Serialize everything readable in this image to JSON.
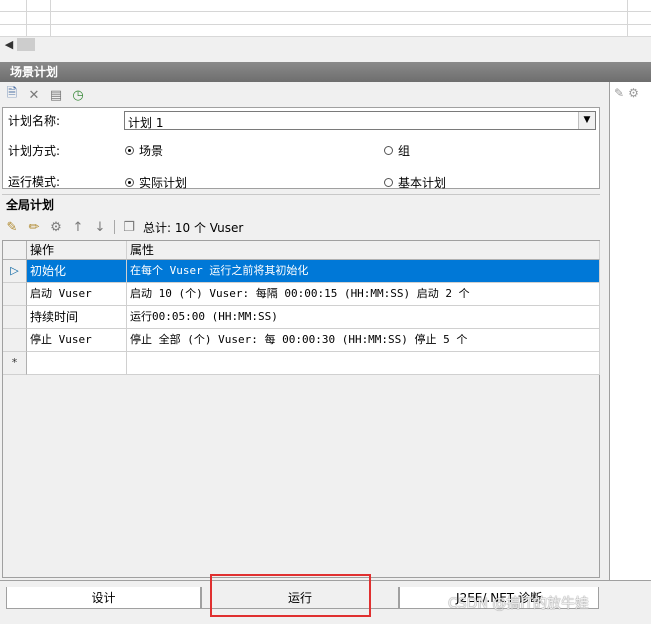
{
  "panel": {
    "title": "场景计划"
  },
  "settings": {
    "plan_name_label": "计划名称:",
    "plan_name_value": "计划 1",
    "plan_mode_label": "计划方式:",
    "plan_mode_options": [
      "场景",
      "组"
    ],
    "run_mode_label": "运行模式:",
    "run_mode_options": [
      "实际计划",
      "基本计划"
    ]
  },
  "global_plan": {
    "title": "全局计划",
    "total": "总计: 10 个 Vuser",
    "columns": [
      "操作",
      "属性"
    ],
    "rows": [
      {
        "op": "初始化",
        "prop": "在每个 Vuser 运行之前将其初始化"
      },
      {
        "op": "启动 Vuser",
        "prop": "启动 10 (个) Vuser: 每隔 00:00:15 (HH:MM:SS) 启动 2 个"
      },
      {
        "op": "持续时间",
        "prop": "运行00:05:00 (HH:MM:SS)"
      },
      {
        "op": "停止 Vuser",
        "prop": "停止 全部 (个) Vuser: 每 00:00:30 (HH:MM:SS) 停止 5 个"
      }
    ],
    "new_row_marker": "*"
  },
  "tabs": [
    "设计",
    "运行",
    "J2EE/.NET 诊断"
  ],
  "watermark": "CSDN @搞IT的放牛娃",
  "colors": {
    "selection": "#0078d7",
    "highlight": "#e03030",
    "panel_title": "#7a7a7a"
  }
}
